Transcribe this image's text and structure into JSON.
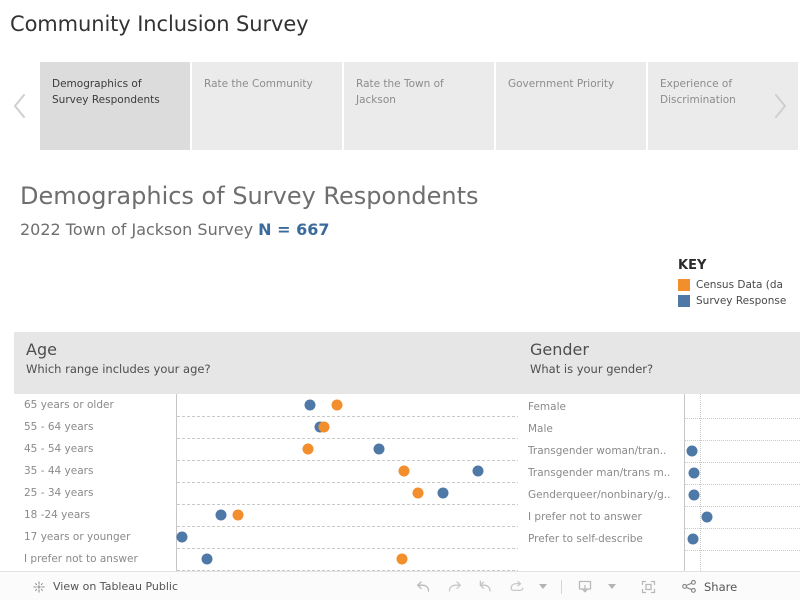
{
  "dashboard": {
    "title": "Community Inclusion Survey"
  },
  "tabstrip": {
    "prev_icon": "chevron-left-icon",
    "next_icon": "chevron-right-icon",
    "tabs": [
      {
        "label": "Demographics of Survey Respondents",
        "active": true
      },
      {
        "label": "Rate the Community",
        "active": false
      },
      {
        "label": "Rate the Town of Jackson",
        "active": false
      },
      {
        "label": "Government Priority",
        "active": false
      },
      {
        "label": "Experience of Discrimination",
        "active": false
      }
    ]
  },
  "sheet": {
    "title": "Demographics of Survey Respondents",
    "subtitle_prefix": "2022 Town of Jackson Survey ",
    "subtitle_value": "N = 667"
  },
  "legend": {
    "title": "KEY",
    "items": [
      {
        "label": "Census Data (da",
        "color": "#F28E2B"
      },
      {
        "label": "Survey Response",
        "color": "#4E79A7"
      }
    ]
  },
  "colors": {
    "census_orange": "#F28E2B",
    "survey_blue": "#4E79A7",
    "accent_blue": "#3A6B9C",
    "panel_header": "#E6E6E6",
    "tab_active": "#DCDCDC",
    "tab_inactive": "#EBEBEB"
  },
  "chart_data": [
    {
      "type": "scatter",
      "id": "age",
      "title": "Age",
      "subtitle": "Which range includes your age?",
      "xlabel": "",
      "ylabel": "",
      "grid": true,
      "legend_position": "external-top-right",
      "categories": [
        "65 years or older",
        "55 - 64 years",
        "45 - 54 years",
        "35 - 44 years",
        "25 - 34 years",
        "18 -24 years",
        "17 years or younger",
        "I prefer not to answer"
      ],
      "xlim": [
        0,
        0.34
      ],
      "series": [
        {
          "name": "Survey Response",
          "color": "#4E79A7",
          "values": [
            0.135,
            0.145,
            0.205,
            0.305,
            0.27,
            0.045,
            0.005,
            0.03
          ]
        },
        {
          "name": "Census Data (da",
          "color": "#F28E2B",
          "values": [
            0.162,
            0.149,
            0.133,
            0.23,
            0.245,
            0.062,
            null,
            0.228
          ]
        }
      ]
    },
    {
      "type": "scatter",
      "id": "gender",
      "title": "Gender",
      "subtitle": "What is your gender?",
      "xlabel": "",
      "ylabel": "",
      "grid": true,
      "categories": [
        "Female",
        "Male",
        "Transgender woman/tran..",
        "Transgender man/trans m..",
        "Genderqueer/nonbinary/g..",
        "I prefer not to answer",
        "Prefer to self-describe"
      ],
      "xlim": [
        0,
        0.6
      ],
      "series": [
        {
          "name": "Survey Response",
          "color": "#4E79A7",
          "values": [
            null,
            null,
            0.04,
            0.048,
            0.053,
            0.125,
            0.045
          ]
        }
      ]
    }
  ],
  "toolbar": {
    "view_label": "View on Tableau Public",
    "view_icon": "tableau-logo-icon",
    "undo_icon": "undo-icon",
    "redo_icon": "redo-icon",
    "revert_icon": "revert-icon",
    "refresh_icon": "refresh-icon",
    "refresh_caret_icon": "chevron-down-icon",
    "download_icon": "download-icon",
    "download_caret_icon": "chevron-down-icon",
    "fullscreen_icon": "fullscreen-icon",
    "share_icon": "share-icon",
    "share_label": "Share"
  }
}
